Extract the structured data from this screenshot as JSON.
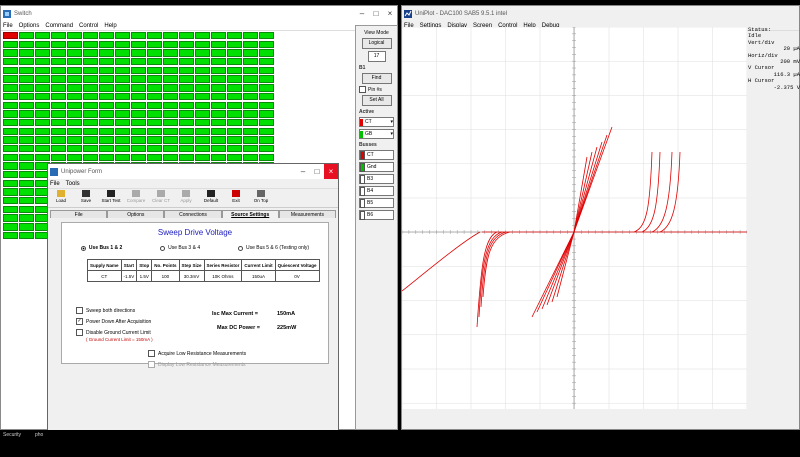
{
  "switch_window": {
    "title": "Switch",
    "menu": [
      "File",
      "Options",
      "Command",
      "Control",
      "Help"
    ],
    "matrix_rows": 24,
    "matrix_cols": 17,
    "colors": {
      "on": "#00e000",
      "selected": "#e00000"
    }
  },
  "side_panel": {
    "view_mode_label": "View Mode",
    "logical_button": "Logical",
    "count_value": "17",
    "section_b1": "B1",
    "find_button": "Find",
    "pin_label": "Pin #s",
    "set_all_button": "Set All",
    "active_label": "Active",
    "active_select": "CT",
    "gnd_select": "GB",
    "busses_label": "Busses",
    "busses": [
      {
        "name": "CT",
        "color": "#e00000"
      },
      {
        "name": "Gnd",
        "color": "#00c000"
      },
      {
        "name": "B3",
        "color": "#ffffff"
      },
      {
        "name": "B4",
        "color": "#ffffff"
      },
      {
        "name": "B5",
        "color": "#ffffff"
      },
      {
        "name": "B6",
        "color": "#ffffff"
      }
    ]
  },
  "scope_window": {
    "title": "UniPlot - DAC100 SAB5 9.5.1 intel",
    "menu": [
      "File",
      "Settings",
      "Display",
      "Screen",
      "Control",
      "Help",
      "Debug"
    ],
    "status": {
      "status_label": "Status:",
      "status_value": "Idle",
      "vert_label": "Vert/div",
      "vert_value": "20 µA",
      "horiz_label": "Horiz/div",
      "horiz_value": "200 mV",
      "v_cursor_label": "V Cursor",
      "v_cursor_value": "116.3 µA",
      "h_cursor_label": "H Cursor",
      "h_cursor_value": "-2.375 V"
    },
    "trace_color": "#e00000"
  },
  "unipower_form": {
    "title": "Unipower Form",
    "menu": [
      "File",
      "Tools"
    ],
    "toolbar": [
      {
        "label": "Load",
        "icon": "folder-icon",
        "enabled": true
      },
      {
        "label": "Save",
        "icon": "floppy-icon",
        "enabled": true
      },
      {
        "label": "Start Test",
        "icon": "arrow-icon",
        "enabled": true
      },
      {
        "label": "Compare",
        "icon": "compare-icon",
        "enabled": false
      },
      {
        "label": "Clear CT",
        "icon": "clear-icon",
        "enabled": false
      },
      {
        "label": "Apply",
        "icon": "apply-icon",
        "enabled": false
      },
      {
        "label": "Default",
        "icon": "undo-icon",
        "enabled": true
      },
      {
        "label": "Exit",
        "icon": "exit-icon",
        "enabled": true
      },
      {
        "label": "On Top",
        "icon": "ontop-icon",
        "enabled": true
      }
    ],
    "tabs": [
      "File",
      "Options",
      "Connections",
      "Source Settings",
      "Measurements"
    ],
    "active_tab": "Source Settings",
    "panel_title": "Sweep Drive Voltage",
    "radios": [
      {
        "label": "Use Bus 1 & 2",
        "selected": true
      },
      {
        "label": "Use Bus 3 & 4",
        "selected": false
      },
      {
        "label": "Use Bus 5 & 6  (Testing only)",
        "selected": false
      }
    ],
    "table_headers": [
      "Supply Name",
      "Start",
      "Stop",
      "No. Points",
      "Step Size",
      "Series Resistor",
      "Current Limit",
      "Quiescent Voltage"
    ],
    "table_row": [
      "CT",
      "-1.5V",
      "1.5V",
      "100",
      "30.3mV",
      "10K Ohms",
      "150uA",
      "0V"
    ],
    "opt_sweep_both": "Sweep both directions",
    "opt_power_down": "Power Down After Acquisition",
    "opt_disable_limit": "Disable Ground Current Limit",
    "ground_note": "( Ground Current Limit = 150mA )",
    "isc_label": "Isc Max Current =",
    "isc_value": "150mA",
    "max_dc_label": "Max DC Power =",
    "max_dc_value": "225mW",
    "acquire_low": "Acquire Low Resistance Measurements",
    "display_low": "Display Low Resistance Measurements"
  },
  "taskbar": {
    "item1": "Security",
    "item2": "pho"
  }
}
